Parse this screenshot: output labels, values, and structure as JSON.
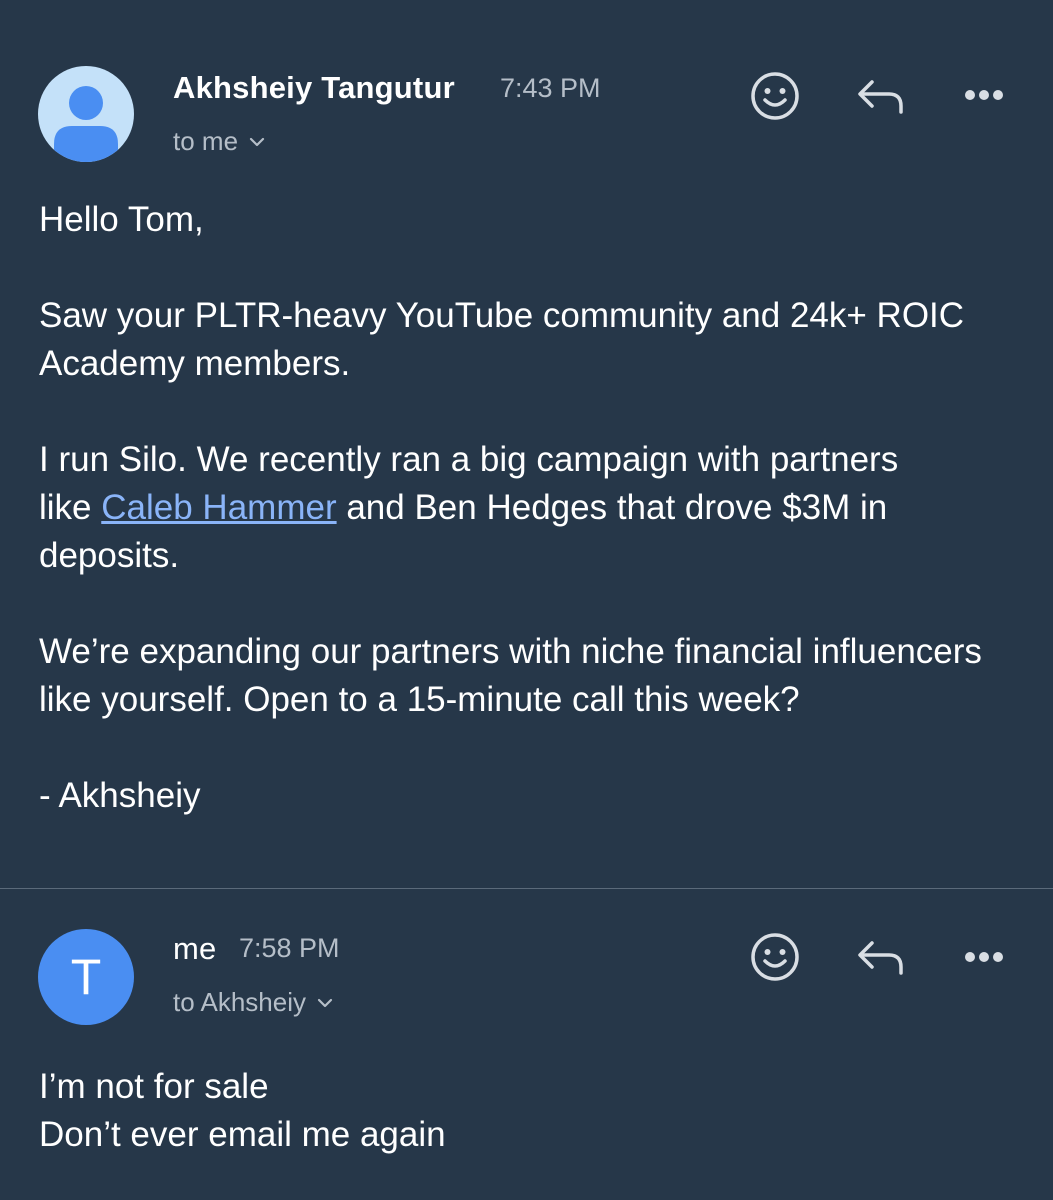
{
  "messages": [
    {
      "sender": "Akhsheiy Tangutur",
      "time": "7:43 PM",
      "recipient": "to me",
      "avatar_icon": "person-icon",
      "body": {
        "greeting": "Hello Tom,",
        "p1": "Saw your PLTR-heavy YouTube community and 24k+ ROIC Academy members.",
        "p2_before": "I run Silo. We recently ran a big campaign with partners like ",
        "p2_link": "Caleb Hammer",
        "p2_after": " and Ben Hedges that drove $3M in deposits.",
        "p3": "We’re expanding our partners with niche financial influencers like yourself.  Open to a 15-minute call this week?",
        "signoff": "- Akhsheiy"
      }
    },
    {
      "sender": "me",
      "time": "7:58 PM",
      "recipient": "to Akhsheiy",
      "avatar_letter": "T",
      "body": {
        "line1": "I’m not for sale",
        "line2": "Don’t ever email me again"
      }
    }
  ],
  "icons": {
    "emoji": "emoji-react-icon",
    "reply": "reply-icon",
    "more": "more-options-icon",
    "chevron": "chevron-down-icon"
  },
  "colors": {
    "background": "#263749",
    "link": "#8ab4f8",
    "avatar_default_bg": "#c4e1f9",
    "avatar_person": "#4a8ef2",
    "avatar_letter_bg": "#4a8ef2",
    "secondary_text": "#b5bec8"
  }
}
